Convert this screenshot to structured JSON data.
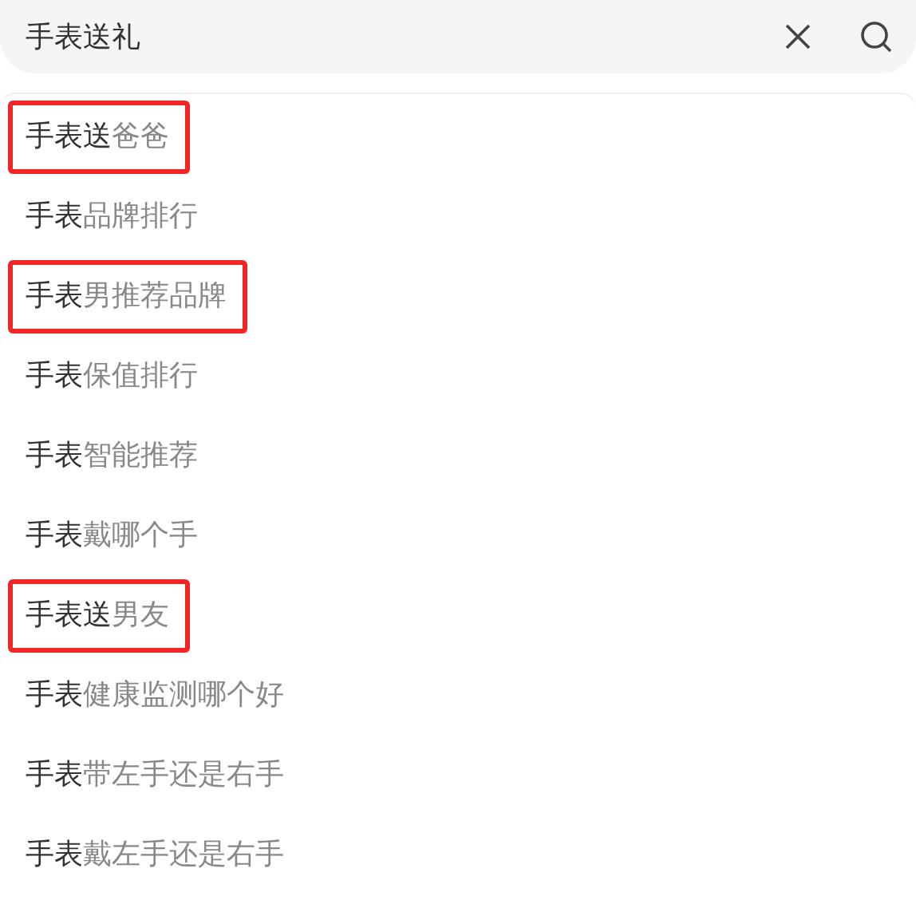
{
  "search": {
    "value": "手表送礼"
  },
  "suggestions": [
    {
      "match": "手表送",
      "rest": "爸爸",
      "highlighted": true
    },
    {
      "match": "手表",
      "rest": "品牌排行",
      "highlighted": false
    },
    {
      "match": "手表",
      "rest": "男推荐品牌",
      "highlighted": true
    },
    {
      "match": "手表",
      "rest": "保值排行",
      "highlighted": false
    },
    {
      "match": "手表",
      "rest": "智能推荐",
      "highlighted": false
    },
    {
      "match": "手表",
      "rest": "戴哪个手",
      "highlighted": false
    },
    {
      "match": "手表送",
      "rest": "男友",
      "highlighted": true
    },
    {
      "match": "手表",
      "rest": "健康监测哪个好",
      "highlighted": false
    },
    {
      "match": "手表",
      "rest": "带左手还是右手",
      "highlighted": false
    },
    {
      "match": "手表",
      "rest": "戴左手还是右手",
      "highlighted": false
    }
  ]
}
